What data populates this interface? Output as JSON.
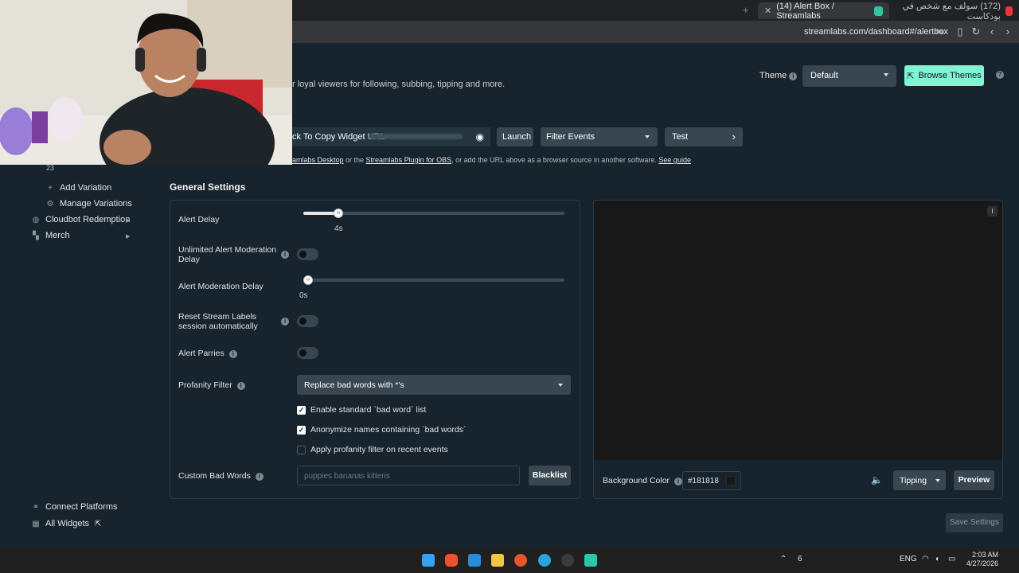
{
  "browser": {
    "new_tab_glyph": "+",
    "active_tab": {
      "title": "(14) Alert Box / Streamlabs",
      "close": "✕"
    },
    "other_tab": {
      "title": "(172) سولف مع شخص في بودكاست"
    },
    "url": "streamlabs.com/dashboard#/alertbox"
  },
  "header": {
    "description": "r loyal viewers for following, subbing, tipping and more.",
    "theme_label": "Theme",
    "theme_value": "Default",
    "browse_themes": "Browse Themes",
    "widget_url_label": "ck To Copy Widget URL",
    "launch": "Launch",
    "filter_events": "Filter Events",
    "test": "Test",
    "help_prefix": "amlabs Desktop",
    "help_or": " or the ",
    "help_plugin": "Streamlabs Plugin for OBS",
    "help_mid": ", or add the URL above as a browser source in another software. ",
    "help_guide": "See guide"
  },
  "sidebar": {
    "count": "23",
    "items": [
      {
        "label": "Add Variation",
        "icon": "plus-icon"
      },
      {
        "label": "Manage Variations",
        "icon": "gear-icon"
      },
      {
        "label": "Cloudbot Redemption",
        "icon": "cloudbot-icon"
      },
      {
        "label": "Merch",
        "icon": "shirt-icon"
      }
    ],
    "bottom": [
      {
        "label": "Connect Platforms",
        "icon": "link-icon"
      },
      {
        "label": "All Widgets",
        "icon": "grid-icon"
      }
    ]
  },
  "settings": {
    "title": "General Settings",
    "alert_delay": {
      "label": "Alert Delay",
      "value": "4s",
      "fraction": 0.134
    },
    "unlimited_moderation": {
      "label": "Unlimited Alert Moderation Delay",
      "on": false
    },
    "moderation_delay": {
      "label": "Alert Moderation Delay",
      "value": "0s",
      "fraction": 0
    },
    "reset_labels": {
      "label": "Reset Stream Labels session automatically",
      "on": false
    },
    "alert_parries": {
      "label": "Alert Parries",
      "on": false
    },
    "profanity": {
      "label": "Profanity Filter",
      "value": "Replace bad words with *'s",
      "options": [
        {
          "label": "Enable standard `bad word` list",
          "checked": true
        },
        {
          "label": "Anonymize names containing `bad words`",
          "checked": true
        },
        {
          "label": "Apply profanity filter on recent events",
          "checked": false
        }
      ]
    },
    "custom_bad_words": {
      "label": "Custom Bad Words",
      "placeholder": "puppies bananas kittens",
      "blacklist": "Blacklist"
    }
  },
  "preview": {
    "bg_label": "Background Color",
    "bg_value": "#181818",
    "event_type": "Tipping",
    "preview_button": "Preview",
    "save_button": "Save Settings"
  },
  "taskbar": {
    "lang": "ENG",
    "time": "2:03 AM",
    "date": "4/27/2026",
    "badge": "6"
  },
  "colors": {
    "background": "#17242d",
    "accent": "#80f5d2",
    "control": "#374650",
    "preview_bg": "#181818"
  }
}
